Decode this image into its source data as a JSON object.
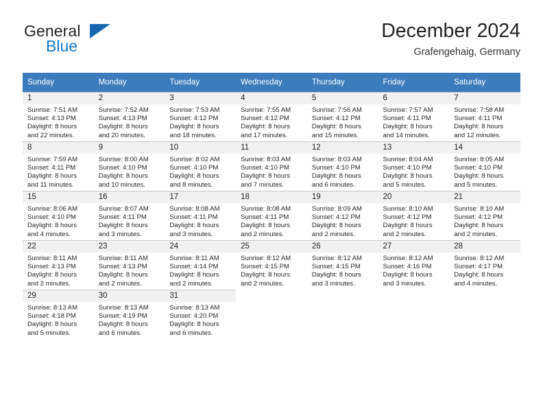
{
  "brand": {
    "name_top": "General",
    "name_bottom": "Blue",
    "accent_color": "#1667b0",
    "text_color": "#1278c8"
  },
  "header": {
    "title": "December 2024",
    "location": "Grafengehaig, Germany",
    "header_bg": "#3b7cbc",
    "daynum_bg": "#f1f1f1"
  },
  "weekdays": [
    "Sunday",
    "Monday",
    "Tuesday",
    "Wednesday",
    "Thursday",
    "Friday",
    "Saturday"
  ],
  "weeks": [
    [
      {
        "day": "1",
        "sunrise": "Sunrise: 7:51 AM",
        "sunset": "Sunset: 4:13 PM",
        "daylight1": "Daylight: 8 hours",
        "daylight2": "and 22 minutes."
      },
      {
        "day": "2",
        "sunrise": "Sunrise: 7:52 AM",
        "sunset": "Sunset: 4:13 PM",
        "daylight1": "Daylight: 8 hours",
        "daylight2": "and 20 minutes."
      },
      {
        "day": "3",
        "sunrise": "Sunrise: 7:53 AM",
        "sunset": "Sunset: 4:12 PM",
        "daylight1": "Daylight: 8 hours",
        "daylight2": "and 18 minutes."
      },
      {
        "day": "4",
        "sunrise": "Sunrise: 7:55 AM",
        "sunset": "Sunset: 4:12 PM",
        "daylight1": "Daylight: 8 hours",
        "daylight2": "and 17 minutes."
      },
      {
        "day": "5",
        "sunrise": "Sunrise: 7:56 AM",
        "sunset": "Sunset: 4:12 PM",
        "daylight1": "Daylight: 8 hours",
        "daylight2": "and 15 minutes."
      },
      {
        "day": "6",
        "sunrise": "Sunrise: 7:57 AM",
        "sunset": "Sunset: 4:11 PM",
        "daylight1": "Daylight: 8 hours",
        "daylight2": "and 14 minutes."
      },
      {
        "day": "7",
        "sunrise": "Sunrise: 7:58 AM",
        "sunset": "Sunset: 4:11 PM",
        "daylight1": "Daylight: 8 hours",
        "daylight2": "and 12 minutes."
      }
    ],
    [
      {
        "day": "8",
        "sunrise": "Sunrise: 7:59 AM",
        "sunset": "Sunset: 4:11 PM",
        "daylight1": "Daylight: 8 hours",
        "daylight2": "and 11 minutes."
      },
      {
        "day": "9",
        "sunrise": "Sunrise: 8:00 AM",
        "sunset": "Sunset: 4:10 PM",
        "daylight1": "Daylight: 8 hours",
        "daylight2": "and 10 minutes."
      },
      {
        "day": "10",
        "sunrise": "Sunrise: 8:02 AM",
        "sunset": "Sunset: 4:10 PM",
        "daylight1": "Daylight: 8 hours",
        "daylight2": "and 8 minutes."
      },
      {
        "day": "11",
        "sunrise": "Sunrise: 8:03 AM",
        "sunset": "Sunset: 4:10 PM",
        "daylight1": "Daylight: 8 hours",
        "daylight2": "and 7 minutes."
      },
      {
        "day": "12",
        "sunrise": "Sunrise: 8:03 AM",
        "sunset": "Sunset: 4:10 PM",
        "daylight1": "Daylight: 8 hours",
        "daylight2": "and 6 minutes."
      },
      {
        "day": "13",
        "sunrise": "Sunrise: 8:04 AM",
        "sunset": "Sunset: 4:10 PM",
        "daylight1": "Daylight: 8 hours",
        "daylight2": "and 5 minutes."
      },
      {
        "day": "14",
        "sunrise": "Sunrise: 8:05 AM",
        "sunset": "Sunset: 4:10 PM",
        "daylight1": "Daylight: 8 hours",
        "daylight2": "and 5 minutes."
      }
    ],
    [
      {
        "day": "15",
        "sunrise": "Sunrise: 8:06 AM",
        "sunset": "Sunset: 4:10 PM",
        "daylight1": "Daylight: 8 hours",
        "daylight2": "and 4 minutes."
      },
      {
        "day": "16",
        "sunrise": "Sunrise: 8:07 AM",
        "sunset": "Sunset: 4:11 PM",
        "daylight1": "Daylight: 8 hours",
        "daylight2": "and 3 minutes."
      },
      {
        "day": "17",
        "sunrise": "Sunrise: 8:08 AM",
        "sunset": "Sunset: 4:11 PM",
        "daylight1": "Daylight: 8 hours",
        "daylight2": "and 3 minutes."
      },
      {
        "day": "18",
        "sunrise": "Sunrise: 8:08 AM",
        "sunset": "Sunset: 4:11 PM",
        "daylight1": "Daylight: 8 hours",
        "daylight2": "and 2 minutes."
      },
      {
        "day": "19",
        "sunrise": "Sunrise: 8:09 AM",
        "sunset": "Sunset: 4:12 PM",
        "daylight1": "Daylight: 8 hours",
        "daylight2": "and 2 minutes."
      },
      {
        "day": "20",
        "sunrise": "Sunrise: 8:10 AM",
        "sunset": "Sunset: 4:12 PM",
        "daylight1": "Daylight: 8 hours",
        "daylight2": "and 2 minutes."
      },
      {
        "day": "21",
        "sunrise": "Sunrise: 8:10 AM",
        "sunset": "Sunset: 4:12 PM",
        "daylight1": "Daylight: 8 hours",
        "daylight2": "and 2 minutes."
      }
    ],
    [
      {
        "day": "22",
        "sunrise": "Sunrise: 8:11 AM",
        "sunset": "Sunset: 4:13 PM",
        "daylight1": "Daylight: 8 hours",
        "daylight2": "and 2 minutes."
      },
      {
        "day": "23",
        "sunrise": "Sunrise: 8:11 AM",
        "sunset": "Sunset: 4:13 PM",
        "daylight1": "Daylight: 8 hours",
        "daylight2": "and 2 minutes."
      },
      {
        "day": "24",
        "sunrise": "Sunrise: 8:11 AM",
        "sunset": "Sunset: 4:14 PM",
        "daylight1": "Daylight: 8 hours",
        "daylight2": "and 2 minutes."
      },
      {
        "day": "25",
        "sunrise": "Sunrise: 8:12 AM",
        "sunset": "Sunset: 4:15 PM",
        "daylight1": "Daylight: 8 hours",
        "daylight2": "and 2 minutes."
      },
      {
        "day": "26",
        "sunrise": "Sunrise: 8:12 AM",
        "sunset": "Sunset: 4:15 PM",
        "daylight1": "Daylight: 8 hours",
        "daylight2": "and 3 minutes."
      },
      {
        "day": "27",
        "sunrise": "Sunrise: 8:12 AM",
        "sunset": "Sunset: 4:16 PM",
        "daylight1": "Daylight: 8 hours",
        "daylight2": "and 3 minutes."
      },
      {
        "day": "28",
        "sunrise": "Sunrise: 8:12 AM",
        "sunset": "Sunset: 4:17 PM",
        "daylight1": "Daylight: 8 hours",
        "daylight2": "and 4 minutes."
      }
    ],
    [
      {
        "day": "29",
        "sunrise": "Sunrise: 8:13 AM",
        "sunset": "Sunset: 4:18 PM",
        "daylight1": "Daylight: 8 hours",
        "daylight2": "and 5 minutes."
      },
      {
        "day": "30",
        "sunrise": "Sunrise: 8:13 AM",
        "sunset": "Sunset: 4:19 PM",
        "daylight1": "Daylight: 8 hours",
        "daylight2": "and 6 minutes."
      },
      {
        "day": "31",
        "sunrise": "Sunrise: 8:13 AM",
        "sunset": "Sunset: 4:20 PM",
        "daylight1": "Daylight: 8 hours",
        "daylight2": "and 6 minutes."
      },
      {
        "day": "",
        "sunrise": "",
        "sunset": "",
        "daylight1": "",
        "daylight2": ""
      },
      {
        "day": "",
        "sunrise": "",
        "sunset": "",
        "daylight1": "",
        "daylight2": ""
      },
      {
        "day": "",
        "sunrise": "",
        "sunset": "",
        "daylight1": "",
        "daylight2": ""
      },
      {
        "day": "",
        "sunrise": "",
        "sunset": "",
        "daylight1": "",
        "daylight2": ""
      }
    ]
  ]
}
